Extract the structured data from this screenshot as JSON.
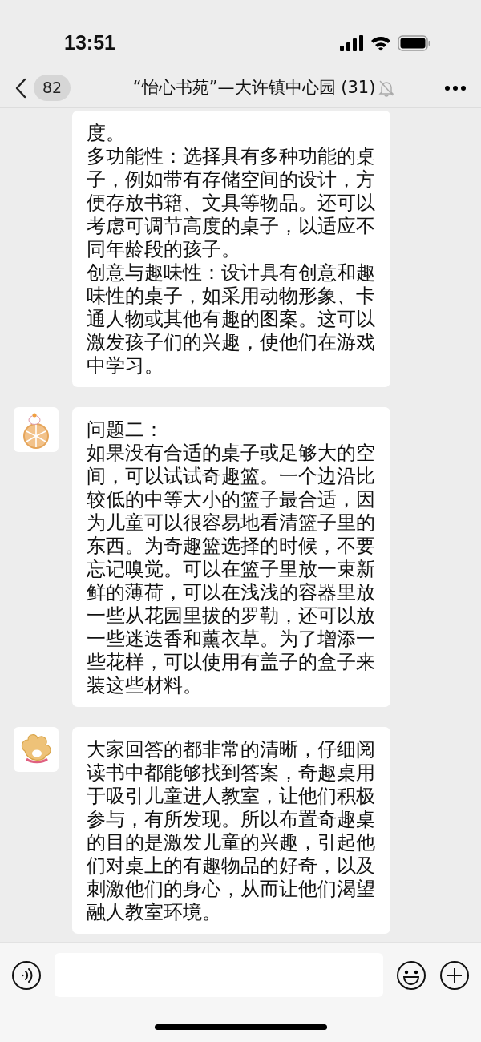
{
  "status_bar": {
    "time": "13:51"
  },
  "header": {
    "back_count": "82",
    "title": "“怡心书苑”—大许镇中心园 (31)",
    "muted": true
  },
  "messages": [
    {
      "avatar_shown": false,
      "paragraphs": [
        "度。",
        "多功能性：选择具有多种功能的桌子，例如带有存储空间的设计，方便存放书籍、文具等物品。还可以考虑可调节高度的桌子，以适应不同年龄段的孩子。",
        "创意与趣味性：设计具有创意和趣味性的桌子，如采用动物形象、卡通人物或其他有趣的图案。这可以激发孩子们的兴趣，使他们在游戏中学习。"
      ]
    },
    {
      "avatar_shown": true,
      "paragraphs": [
        "问题二：",
        "如果没有合适的桌子或足够大的空间，可以试试奇趣篮。一个边沿比较低的中等大小的篮子最合适，因为儿童可以很容易地看清篮子里的东西。为奇趣篮选择的时候，不要忘记嗅觉。可以在篮子里放一束新鲜的薄荷，可以在浅浅的容器里放一些从花园里拔的罗勒，还可以放一些迷迭香和薰衣草。为了增添一些花样，可以使用有盖子的盒子来装这些材料。"
      ]
    },
    {
      "avatar_shown": true,
      "paragraphs": [
        "大家回答的都非常的清晰，仔细阅读书中都能够找到答案，奇趣桌用于吸引儿童进人教室，让他们积极参与，有所发现。所以布置奇趣桌的目的是激发儿童的兴趣，引起他们对桌上的有趣物品的好奇，以及刺激他们的身心，从而让他们渴望融人教室环境。"
      ]
    }
  ]
}
